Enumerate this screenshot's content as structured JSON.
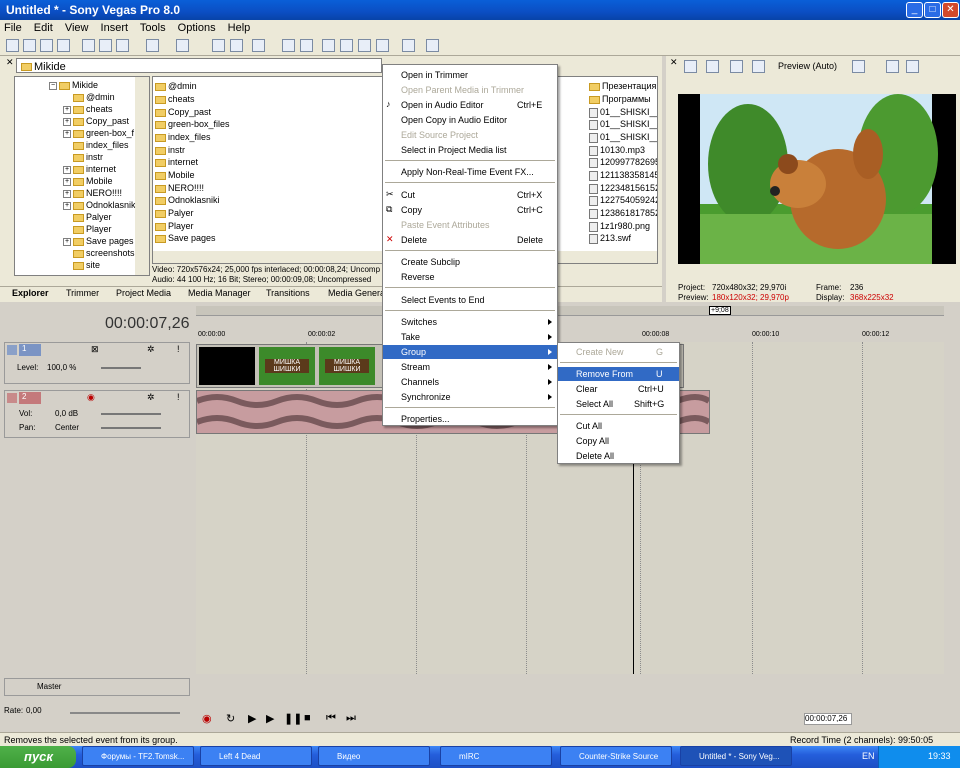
{
  "window": {
    "title": "Untitled * - Sony Vegas Pro 8.0"
  },
  "menubar": [
    "File",
    "Edit",
    "View",
    "Insert",
    "Tools",
    "Options",
    "Help"
  ],
  "explorer": {
    "path": "Mikide",
    "tree": [
      "Mikide",
      "@dmin",
      "cheats",
      "Copy_past",
      "green-box_f",
      "index_files",
      "instr",
      "internet",
      "Mobile",
      "NERO!!!!",
      "Odnoklasniki",
      "Palyer",
      "Player",
      "Save pages",
      "screenshots",
      "site"
    ],
    "files_col1": [
      "@dmin",
      "cheats",
      "Copy_past",
      "green-box_files",
      "index_files",
      "instr",
      "internet",
      "Mobile",
      "NERO!!!!",
      "Odnoklasniki",
      "Palyer",
      "Player",
      "Save pages"
    ],
    "files_col3": [
      "Презентация",
      "Программы",
      "01__SHISKI__2",
      "01__SHISKI__2",
      "01__SHISKI__2",
      "10130.mp3",
      "120997782695",
      "121138358145",
      "122348156152",
      "122754059242",
      "123861817852",
      "1z1r980.png",
      "213.swf"
    ],
    "info_video": "Video: 720x576x24; 25,000 fps interlaced; 00:00:08,24; Uncomp",
    "info_audio": "Audio: 44 100 Hz; 16 Bit; Stereo; 00:00:09,08; Uncompressed"
  },
  "tabs": [
    "Explorer",
    "Trimmer",
    "Project Media",
    "Media Manager",
    "Transitions",
    "Media Generat"
  ],
  "preview": {
    "mode": "Preview (Auto)",
    "project_label": "Project:",
    "project_value": "720x480x32; 29,970i",
    "preview_label": "Preview:",
    "preview_value": "180x120x32; 29,970p",
    "frame_label": "Frame:",
    "frame_value": "236",
    "display_label": "Display:",
    "display_value": "368x225x32"
  },
  "timeline": {
    "time": "00:00:07,26",
    "marker": "+9;08",
    "ruler": [
      "00:00:00",
      "00:00:02",
      "00:00:08",
      "00:00:10",
      "00:00:12"
    ]
  },
  "tracks": {
    "video": {
      "number": "1",
      "level_label": "Level:",
      "level_value": "100,0 %"
    },
    "audio": {
      "number": "2",
      "vol_label": "Vol:",
      "vol_value": "0,0 dB",
      "pan_label": "Pan:",
      "pan_value": "Center"
    },
    "master_label": "Master",
    "rate_label": "Rate:",
    "rate_value": "0,00",
    "clip_text": "МИШКА\nШИШКИ"
  },
  "context_menu": [
    {
      "label": "Open in Trimmer",
      "shortcut": "",
      "disabled": false
    },
    {
      "label": "Open Parent Media in Trimmer",
      "shortcut": "",
      "disabled": true
    },
    {
      "label": "Open in Audio Editor",
      "shortcut": "Ctrl+E",
      "disabled": false
    },
    {
      "label": "Open Copy in Audio Editor",
      "shortcut": "",
      "disabled": false
    },
    {
      "label": "Edit Source Project",
      "shortcut": "",
      "disabled": true
    },
    {
      "label": "Select in Project Media list",
      "shortcut": "",
      "disabled": false
    },
    {
      "label": "Apply Non-Real-Time Event FX...",
      "shortcut": "",
      "disabled": false
    },
    {
      "label": "Cut",
      "shortcut": "Ctrl+X",
      "disabled": false
    },
    {
      "label": "Copy",
      "shortcut": "Ctrl+C",
      "disabled": false
    },
    {
      "label": "Paste Event Attributes",
      "shortcut": "",
      "disabled": true
    },
    {
      "label": "Delete",
      "shortcut": "Delete",
      "disabled": false
    },
    {
      "label": "Create Subclip",
      "shortcut": "",
      "disabled": false
    },
    {
      "label": "Reverse",
      "shortcut": "",
      "disabled": false
    },
    {
      "label": "Select Events to End",
      "shortcut": "",
      "disabled": false
    },
    {
      "label": "Switches",
      "shortcut": "",
      "disabled": false
    },
    {
      "label": "Take",
      "shortcut": "",
      "disabled": false
    },
    {
      "label": "Group",
      "shortcut": "",
      "disabled": false
    },
    {
      "label": "Stream",
      "shortcut": "",
      "disabled": false
    },
    {
      "label": "Channels",
      "shortcut": "",
      "disabled": false
    },
    {
      "label": "Synchronize",
      "shortcut": "",
      "disabled": false
    },
    {
      "label": "Properties...",
      "shortcut": "",
      "disabled": false
    }
  ],
  "submenu": [
    {
      "label": "Create New",
      "shortcut": "G",
      "disabled": true
    },
    {
      "label": "Remove From",
      "shortcut": "U",
      "disabled": false
    },
    {
      "label": "Clear",
      "shortcut": "Ctrl+U",
      "disabled": false
    },
    {
      "label": "Select All",
      "shortcut": "Shift+G",
      "disabled": false
    },
    {
      "label": "Cut All",
      "shortcut": "",
      "disabled": false
    },
    {
      "label": "Copy All",
      "shortcut": "",
      "disabled": false
    },
    {
      "label": "Delete All",
      "shortcut": "",
      "disabled": false
    }
  ],
  "transport": {
    "time": "00:00:07,26"
  },
  "status": {
    "text": "Removes the selected event from its group.",
    "record_time": "Record Time (2 channels): 99:50:05"
  },
  "taskbar": {
    "start": "пуск",
    "tasks": [
      "Форумы - TF2.Tomsk...",
      "Left 4 Dead",
      "Видео",
      "mIRC",
      "Counter-Strike Source",
      "Untitled * - Sony Veg..."
    ],
    "lang": "EN",
    "clock": "19:33"
  }
}
